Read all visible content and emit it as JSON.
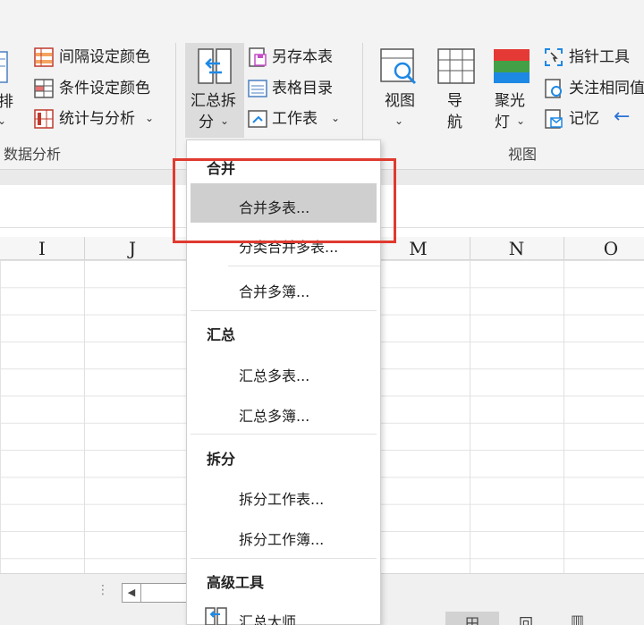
{
  "ribbon": {
    "left_cut_label_1": "排",
    "left_cut_label_2": "⌄",
    "group_data_analysis": "数据分析",
    "interval_color": "间隔设定颜色",
    "conditional_color": "条件设定颜色",
    "stats_analysis": "统计与分析",
    "merge_split_line1": "汇总拆",
    "merge_split_line2": "分",
    "save_sheet": "另存本表",
    "sheet_catalog": "表格目录",
    "worksheet": "工作表",
    "view": "视图",
    "nav_line1": "导",
    "nav_line2": "航",
    "spotlight_line1": "聚光",
    "spotlight_line2": "灯",
    "pointer_tool": "指针工具",
    "watch_same": "关注相同值",
    "memory": "记忆",
    "group_view": "视图",
    "arrow_left": "←",
    "chevron": "⌄",
    "colors": {
      "spot_red": "#e53935",
      "spot_green": "#43a047",
      "spot_blue": "#1e88e5",
      "accent_blue": "#2b73d6"
    }
  },
  "columns": [
    "I",
    "J",
    "M",
    "N",
    "O"
  ],
  "menu": {
    "section_merge": "合并",
    "merge_multi_sheets": "合并多表...",
    "classify_merge": "分类合并多表...",
    "merge_multi_books": "合并多簿...",
    "section_summary": "汇总",
    "summary_multi_sheets": "汇总多表...",
    "summary_multi_books": "汇总多簿...",
    "section_split": "拆分",
    "split_worksheet": "拆分工作表...",
    "split_workbook": "拆分工作簿...",
    "section_advanced": "高级工具",
    "summary_master": "汇总大师..."
  },
  "status": {
    "dots": "⋮",
    "scroll_left": "◀",
    "view_normal": "田",
    "view_page": "回",
    "view_break": "▥"
  },
  "highlight_color": "#e03a2f"
}
